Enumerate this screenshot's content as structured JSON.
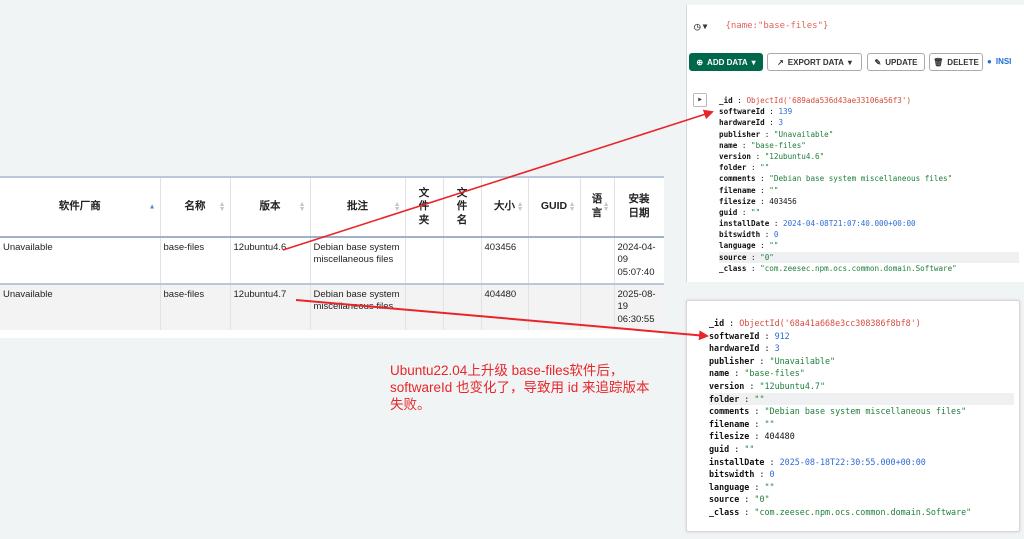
{
  "table": {
    "headers": [
      {
        "label": "软件厂商",
        "sort": "asc"
      },
      {
        "label": "名称",
        "sort": "both"
      },
      {
        "label": "版本",
        "sort": "both"
      },
      {
        "label": "批注",
        "sort": "both"
      },
      {
        "label": "文\n件\n夹",
        "sort": ""
      },
      {
        "label": "文\n件\n名",
        "sort": ""
      },
      {
        "label": "大小",
        "sort": "both"
      },
      {
        "label": "GUID",
        "sort": "both"
      },
      {
        "label": "语\n言",
        "sort": "both"
      },
      {
        "label": "安装\n日期",
        "sort": ""
      }
    ],
    "rows": [
      {
        "vendor": "Unavailable",
        "name": "base-files",
        "version": "12ubuntu4.6",
        "comment": "Debian base system\nmiscellaneous files",
        "folder": "",
        "filename": "",
        "size": "403456",
        "guid": "",
        "language": "",
        "install_date": "2024-04-\n09\n05:07:40"
      },
      {
        "vendor": "Unavailable",
        "name": "base-files",
        "version": "12ubuntu4.7",
        "comment": "Debian base system\nmiscellaneous files",
        "folder": "",
        "filename": "",
        "size": "404480",
        "guid": "",
        "language": "",
        "install_date": "2025-08-\n19\n06:30:55"
      }
    ]
  },
  "mongo_top": {
    "query": "{name:\"base-files\"}",
    "buttons": {
      "add": "ADD DATA",
      "export": "EXPORT DATA",
      "update": "UPDATE",
      "delete": "DELETE",
      "insights": "INSI"
    },
    "fields": [
      {
        "key": "_id",
        "value": "ObjectId('689ada536d43ae33106a56f3')",
        "type": "oid"
      },
      {
        "key": "softwareId",
        "value": "139",
        "type": "num"
      },
      {
        "key": "hardwareId",
        "value": "3",
        "type": "num"
      },
      {
        "key": "publisher",
        "value": "\"Unavailable\"",
        "type": "str"
      },
      {
        "key": "name",
        "value": "\"base-files\"",
        "type": "str"
      },
      {
        "key": "version",
        "value": "\"12ubuntu4.6\"",
        "type": "str"
      },
      {
        "key": "folder",
        "value": "\"\"",
        "type": "str"
      },
      {
        "key": "comments",
        "value": "\"Debian base system miscellaneous files\"",
        "type": "str"
      },
      {
        "key": "filename",
        "value": "\"\"",
        "type": "str"
      },
      {
        "key": "filesize",
        "value": "403456",
        "type": "plain"
      },
      {
        "key": "guid",
        "value": "\"\"",
        "type": "str"
      },
      {
        "key": "installDate",
        "value": "2024-04-08T21:07:40.000+00:00",
        "type": "num"
      },
      {
        "key": "bitswidth",
        "value": "0",
        "type": "num"
      },
      {
        "key": "language",
        "value": "\"\"",
        "type": "str"
      },
      {
        "key": "source",
        "value": "\"0\"",
        "type": "str",
        "highlight": true
      },
      {
        "key": "_class",
        "value": "\"com.zeesec.npm.ocs.common.domain.Software\"",
        "type": "str"
      }
    ]
  },
  "mongo_bottom": {
    "fields": [
      {
        "key": "_id",
        "value": "ObjectId('68a41a668e3cc308386f8bf8')",
        "type": "oid"
      },
      {
        "key": "softwareId",
        "value": "912",
        "type": "num"
      },
      {
        "key": "hardwareId",
        "value": "3",
        "type": "num"
      },
      {
        "key": "publisher",
        "value": "\"Unavailable\"",
        "type": "str"
      },
      {
        "key": "name",
        "value": "\"base-files\"",
        "type": "str"
      },
      {
        "key": "version",
        "value": "\"12ubuntu4.7\"",
        "type": "str"
      },
      {
        "key": "folder",
        "value": "\"\"",
        "type": "str",
        "highlight": true
      },
      {
        "key": "comments",
        "value": "\"Debian base system miscellaneous files\"",
        "type": "str"
      },
      {
        "key": "filename",
        "value": "\"\"",
        "type": "str"
      },
      {
        "key": "filesize",
        "value": "404480",
        "type": "plain"
      },
      {
        "key": "guid",
        "value": "\"\"",
        "type": "str"
      },
      {
        "key": "installDate",
        "value": "2025-08-18T22:30:55.000+00:00",
        "type": "num"
      },
      {
        "key": "bitswidth",
        "value": "0",
        "type": "num"
      },
      {
        "key": "language",
        "value": "\"\"",
        "type": "str"
      },
      {
        "key": "source",
        "value": "\"0\"",
        "type": "str"
      },
      {
        "key": "_class",
        "value": "\"com.zeesec.npm.ocs.common.domain.Software\"",
        "type": "str"
      }
    ]
  },
  "annotation": {
    "text": "Ubuntu22.04上升级 base-files软件后，softwareId 也变化了，导致用 id 来追踪版本失败。",
    "color": "#e8262a"
  },
  "icons": [
    "clock-icon",
    "plus-circle-icon",
    "export-icon",
    "pencil-icon",
    "trash-icon",
    "lightbulb-icon",
    "expand-icon"
  ]
}
